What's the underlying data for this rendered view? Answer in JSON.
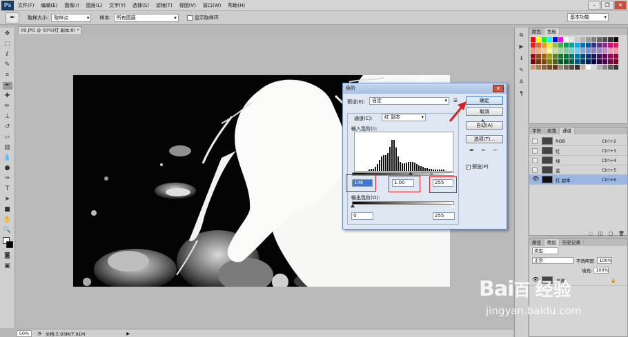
{
  "menubar": {
    "logo": "Ps",
    "items": [
      "文件(F)",
      "编辑(E)",
      "图像(I)",
      "图层(L)",
      "文字(Y)",
      "选择(S)",
      "滤镜(T)",
      "视图(V)",
      "窗口(W)",
      "帮助(H)"
    ]
  },
  "optbar": {
    "sample_size_label": "取样大小:",
    "sample_size_value": "取样点",
    "sample_label": "样本:",
    "sample_value": "所有图层",
    "show_ring_label": "显示取样环",
    "workspace_value": "基本功能"
  },
  "document": {
    "tab_title": "09.JPG @ 50%(红 副本/8) *"
  },
  "statusbar": {
    "zoom": "50%",
    "doc_info": "文档:5.93M/7.91M"
  },
  "swatches_panel": {
    "tabs": [
      "颜色",
      "色板"
    ],
    "active": "色板"
  },
  "channels_panel": {
    "tabs": [
      "字符",
      "段落",
      "通道"
    ],
    "rows": [
      {
        "name": "RGB",
        "shortcut": "Ctrl+2",
        "visible": false,
        "selected": false
      },
      {
        "name": "红",
        "shortcut": "Ctrl+3",
        "visible": false,
        "selected": false
      },
      {
        "name": "绿",
        "shortcut": "Ctrl+4",
        "visible": false,
        "selected": false
      },
      {
        "name": "蓝",
        "shortcut": "Ctrl+5",
        "visible": false,
        "selected": false
      },
      {
        "name": "红 副本",
        "shortcut": "Ctrl+6",
        "visible": true,
        "selected": true
      }
    ]
  },
  "layers_panel": {
    "tabs": [
      "路径",
      "图层",
      "历史记录"
    ],
    "filter_value": "类型",
    "blend_mode": "正常",
    "opacity_label": "不透明度:",
    "opacity_value": "100%",
    "fill_label": "填充:",
    "fill_value": "100%",
    "layer_name": "背景"
  },
  "levels_dialog": {
    "title": "色阶",
    "preset_label": "预设(E):",
    "preset_value": "自定",
    "channel_label": "通道(C):",
    "channel_value": "红 副本",
    "input_levels_label": "输入色阶(I):",
    "input_black": "146",
    "input_gamma": "1.00",
    "input_white": "255",
    "output_levels_label": "输出色阶(O):",
    "output_black": "0",
    "output_white": "255",
    "buttons": {
      "ok": "确定",
      "cancel": "取消",
      "auto": "自动(A)",
      "options": "选项(T)..."
    },
    "preview_label": "预览(P)",
    "preview_checked": true
  },
  "watermark": {
    "brand": "Bai",
    "brand_suffix": "百",
    "brand_cn": "经验",
    "url": "jingyan.baidu.com"
  },
  "colors": {
    "accent_red": "#d81f26",
    "selection_blue": "#9bb6e3"
  }
}
